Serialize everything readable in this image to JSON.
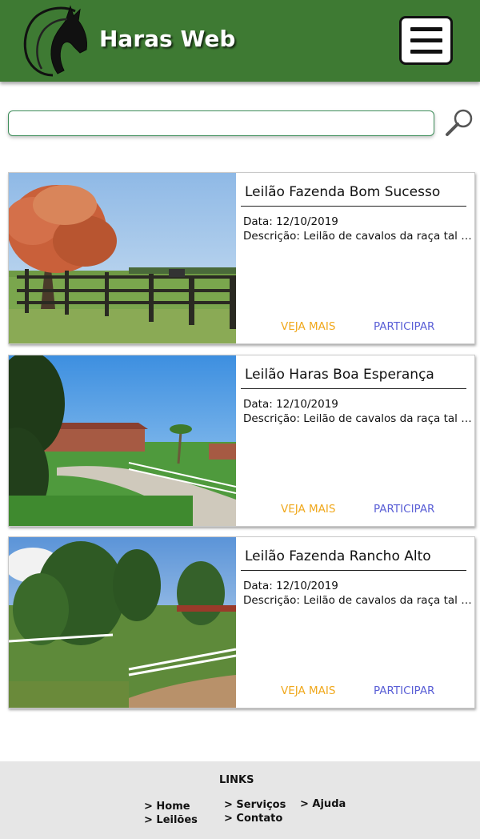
{
  "header": {
    "brand": "Haras Web",
    "logo_icon": "horse-head-icon",
    "menu_icon": "hamburger-menu-icon",
    "background_color": "#3e7a33"
  },
  "search": {
    "value": "",
    "placeholder": "",
    "icon": "search-icon"
  },
  "cards": [
    {
      "title": "Leilão Fazenda Bom Sucesso",
      "date": "Data: 12/10/2019",
      "description": "Descrição: Leilão de cavalos da raça tal e tal...",
      "more_label": "VEJA MAIS",
      "join_label": "PARTICIPAR"
    },
    {
      "title": "Leilão Haras Boa Esperança",
      "date": "Data: 12/10/2019",
      "description": "Descrição: Leilão de cavalos da raça tal e tal...",
      "more_label": "VEJA MAIS",
      "join_label": "PARTICIPAR"
    },
    {
      "title": "Leilão Fazenda Rancho Alto",
      "date": "Data: 12/10/2019",
      "description": "Descrição: Leilão de cavalos da raça tal e tal...",
      "more_label": "VEJA MAIS",
      "join_label": "PARTICIPAR"
    }
  ],
  "colors": {
    "more": "#f0a81c",
    "join": "#5a5fd6",
    "footer_bg": "#e6e6e6"
  },
  "footer": {
    "title": "LINKS",
    "links": {
      "home": "> Home",
      "leiloes": "> Leilões",
      "servicos": "> Serviços",
      "contato": "> Contato",
      "ajuda": "> Ajuda"
    }
  }
}
